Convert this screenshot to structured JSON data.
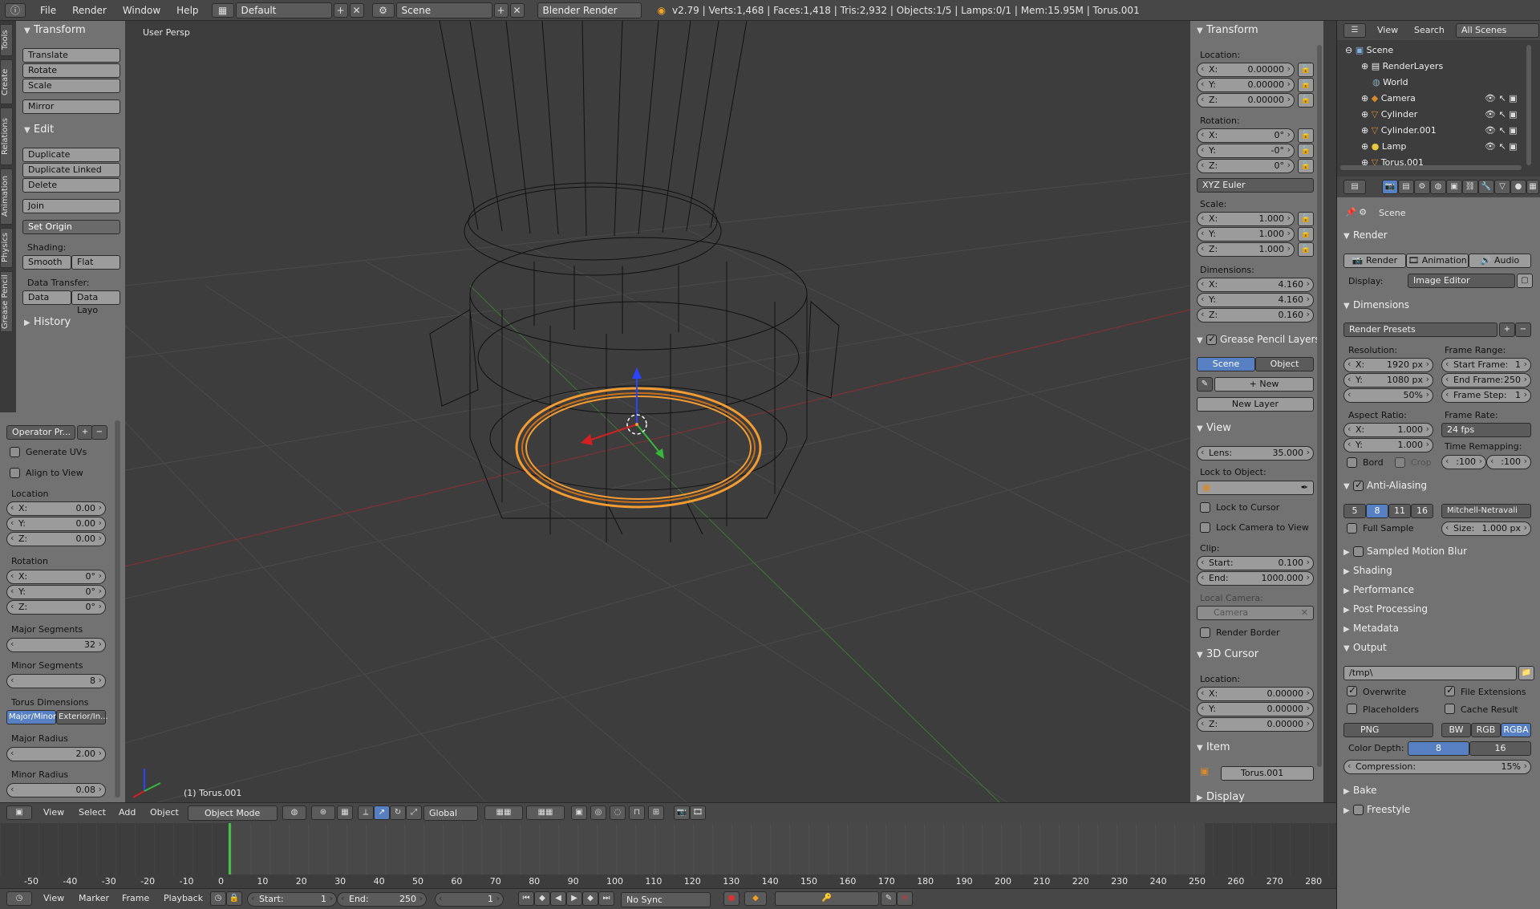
{
  "topbar": {
    "menus": [
      "File",
      "Render",
      "Window",
      "Help"
    ],
    "layout": "Default",
    "scene": "Scene",
    "engine": "Blender Render",
    "stats": "v2.79 | Verts:1,468 | Faces:1,418 | Tris:2,932 | Objects:1/5 | Lamps:0/1 | Mem:15.95M | Torus.001"
  },
  "tools": {
    "tabs": [
      "Tools",
      "Create",
      "Relations",
      "Animation",
      "Physics",
      "Grease Pencil"
    ],
    "transform_title": "Transform",
    "translate": "Translate",
    "rotate": "Rotate",
    "scale": "Scale",
    "mirror": "Mirror",
    "edit_title": "Edit",
    "duplicate": "Duplicate",
    "duplicate_linked": "Duplicate Linked",
    "delete": "Delete",
    "join": "Join",
    "set_origin": "Set Origin",
    "shading_label": "Shading:",
    "smooth": "Smooth",
    "flat": "Flat",
    "data_transfer_label": "Data Transfer:",
    "data": "Data",
    "data_layo": "Data Layo",
    "history_title": "History"
  },
  "operator": {
    "presets": "Operator Pr...",
    "generate_uvs": "Generate UVs",
    "align_to_view": "Align to View",
    "location_label": "Location",
    "loc_x": "0.00",
    "loc_y": "0.00",
    "loc_z": "0.00",
    "rotation_label": "Rotation",
    "rot_x": "0°",
    "rot_y": "0°",
    "rot_z": "0°",
    "major_segments_label": "Major Segments",
    "major_segments": "32",
    "minor_segments_label": "Minor Segments",
    "minor_segments": "8",
    "torus_dims_label": "Torus Dimensions",
    "mode_a": "Major/Minor",
    "mode_b": "Exterior/In...",
    "major_radius_label": "Major Radius",
    "major_radius": "2.00",
    "minor_radius_label": "Minor Radius",
    "minor_radius": "0.08",
    "x": "X:",
    "y": "Y:",
    "z": "Z:"
  },
  "viewport": {
    "label": "User Persp",
    "object_label": "(1) Torus.001"
  },
  "props": {
    "transform_title": "Transform",
    "location_label": "Location:",
    "loc_x": "0.00000",
    "loc_y": "0.00000",
    "loc_z": "0.00000",
    "rotation_label": "Rotation:",
    "rot_x": "0°",
    "rot_y": "-0°",
    "rot_z": "0°",
    "rotation_mode": "XYZ Euler",
    "scale_label": "Scale:",
    "sc_x": "1.000",
    "sc_y": "1.000",
    "sc_z": "1.000",
    "dimensions_label": "Dimensions:",
    "dim_x": "4.160",
    "dim_y": "4.160",
    "dim_z": "0.160",
    "gp_title": "Grease Pencil Layers",
    "gp_scene": "Scene",
    "gp_object": "Object",
    "gp_new": "New",
    "gp_new_layer": "New Layer",
    "view_title": "View",
    "lens_label": "Lens:",
    "lens": "35.000",
    "lock_object_label": "Lock to Object:",
    "lock_cursor": "Lock to Cursor",
    "lock_camera": "Lock Camera to View",
    "clip_label": "Clip:",
    "clip_start_label": "Start:",
    "clip_start": "0.100",
    "clip_end_label": "End:",
    "clip_end": "1000.000",
    "local_camera_label": "Local Camera:",
    "local_camera": "Camera",
    "render_border": "Render Border",
    "cursor_title": "3D Cursor",
    "cursor_location": "Location:",
    "cur_x": "0.00000",
    "cur_y": "0.00000",
    "cur_z": "0.00000",
    "item_title": "Item",
    "item_name": "Torus.001",
    "display_title": "Display",
    "x": "X:",
    "y": "Y:",
    "z": "Z:"
  },
  "outliner": {
    "view": "View",
    "search": "Search",
    "filter": "All Scenes",
    "items": [
      "Scene",
      "RenderLayers",
      "World",
      "Camera",
      "Cylinder",
      "Cylinder.001",
      "Lamp",
      "Torus.001"
    ]
  },
  "render": {
    "context": "Scene",
    "render_title": "Render",
    "btn_render": "Render",
    "btn_animation": "Animation",
    "btn_audio": "Audio",
    "display_label": "Display:",
    "display_value": "Image Editor",
    "dimensions_title": "Dimensions",
    "presets": "Render Presets",
    "resolution_label": "Resolution:",
    "res_x": "1920 px",
    "res_y": "1080 px",
    "res_pct": "50%",
    "frame_range_label": "Frame Range:",
    "start_frame_label": "Start Frame:",
    "start_frame": "1",
    "end_frame_label": "End Frame:",
    "end_frame": "250",
    "frame_step_label": "Frame Step:",
    "frame_step": "1",
    "aspect_label": "Aspect Ratio:",
    "asp_x": "1.000",
    "asp_y": "1.000",
    "frame_rate_label": "Frame Rate:",
    "frame_rate": "24 fps",
    "bord": "Bord",
    "crop": "Crop",
    "time_remap_label": "Time Remapping:",
    "remap_old": ":100",
    "remap_new": ":100",
    "aa_title": "Anti-Aliasing",
    "aa_samples": [
      "5",
      "8",
      "11",
      "16"
    ],
    "aa_filter": "Mitchell-Netravali",
    "full_sample": "Full Sample",
    "size_label": "Size:",
    "size": "1.000 px",
    "smb": "Sampled Motion Blur",
    "shading": "Shading",
    "performance": "Performance",
    "post_processing": "Post Processing",
    "metadata": "Metadata",
    "output_title": "Output",
    "output_path": "/tmp\\",
    "overwrite": "Overwrite",
    "file_ext": "File Extensions",
    "placeholders": "Placeholders",
    "cache_result": "Cache Result",
    "format": "PNG",
    "bw": "BW",
    "rgb": "RGB",
    "rgba": "RGBA",
    "color_depth_label": "Color Depth:",
    "depth8": "8",
    "depth16": "16",
    "compression_label": "Compression:",
    "compression": "15%",
    "bake": "Bake",
    "freestyle": "Freestyle",
    "x": "X:",
    "y": "Y:"
  },
  "view3d_header": {
    "view": "View",
    "select": "Select",
    "add": "Add",
    "object": "Object",
    "mode": "Object Mode",
    "orientation": "Global"
  },
  "timeline": {
    "ticks": [
      "-50",
      "-40",
      "-30",
      "-20",
      "-10",
      "0",
      "10",
      "20",
      "30",
      "40",
      "50",
      "60",
      "70",
      "80",
      "90",
      "100",
      "110",
      "120",
      "130",
      "140",
      "150",
      "160",
      "170",
      "180",
      "190",
      "200",
      "210",
      "220",
      "230",
      "240",
      "250",
      "260",
      "270",
      "280"
    ],
    "view": "View",
    "marker": "Marker",
    "frame": "Frame",
    "playback": "Playback",
    "start_label": "Start:",
    "start": "1",
    "end_label": "End:",
    "end": "250",
    "current": "1",
    "sync": "No Sync"
  },
  "colors": {
    "accent": "#5680c2",
    "selection": "#f39c32",
    "panel": "#727272",
    "viewport": "#3d3d3d"
  }
}
